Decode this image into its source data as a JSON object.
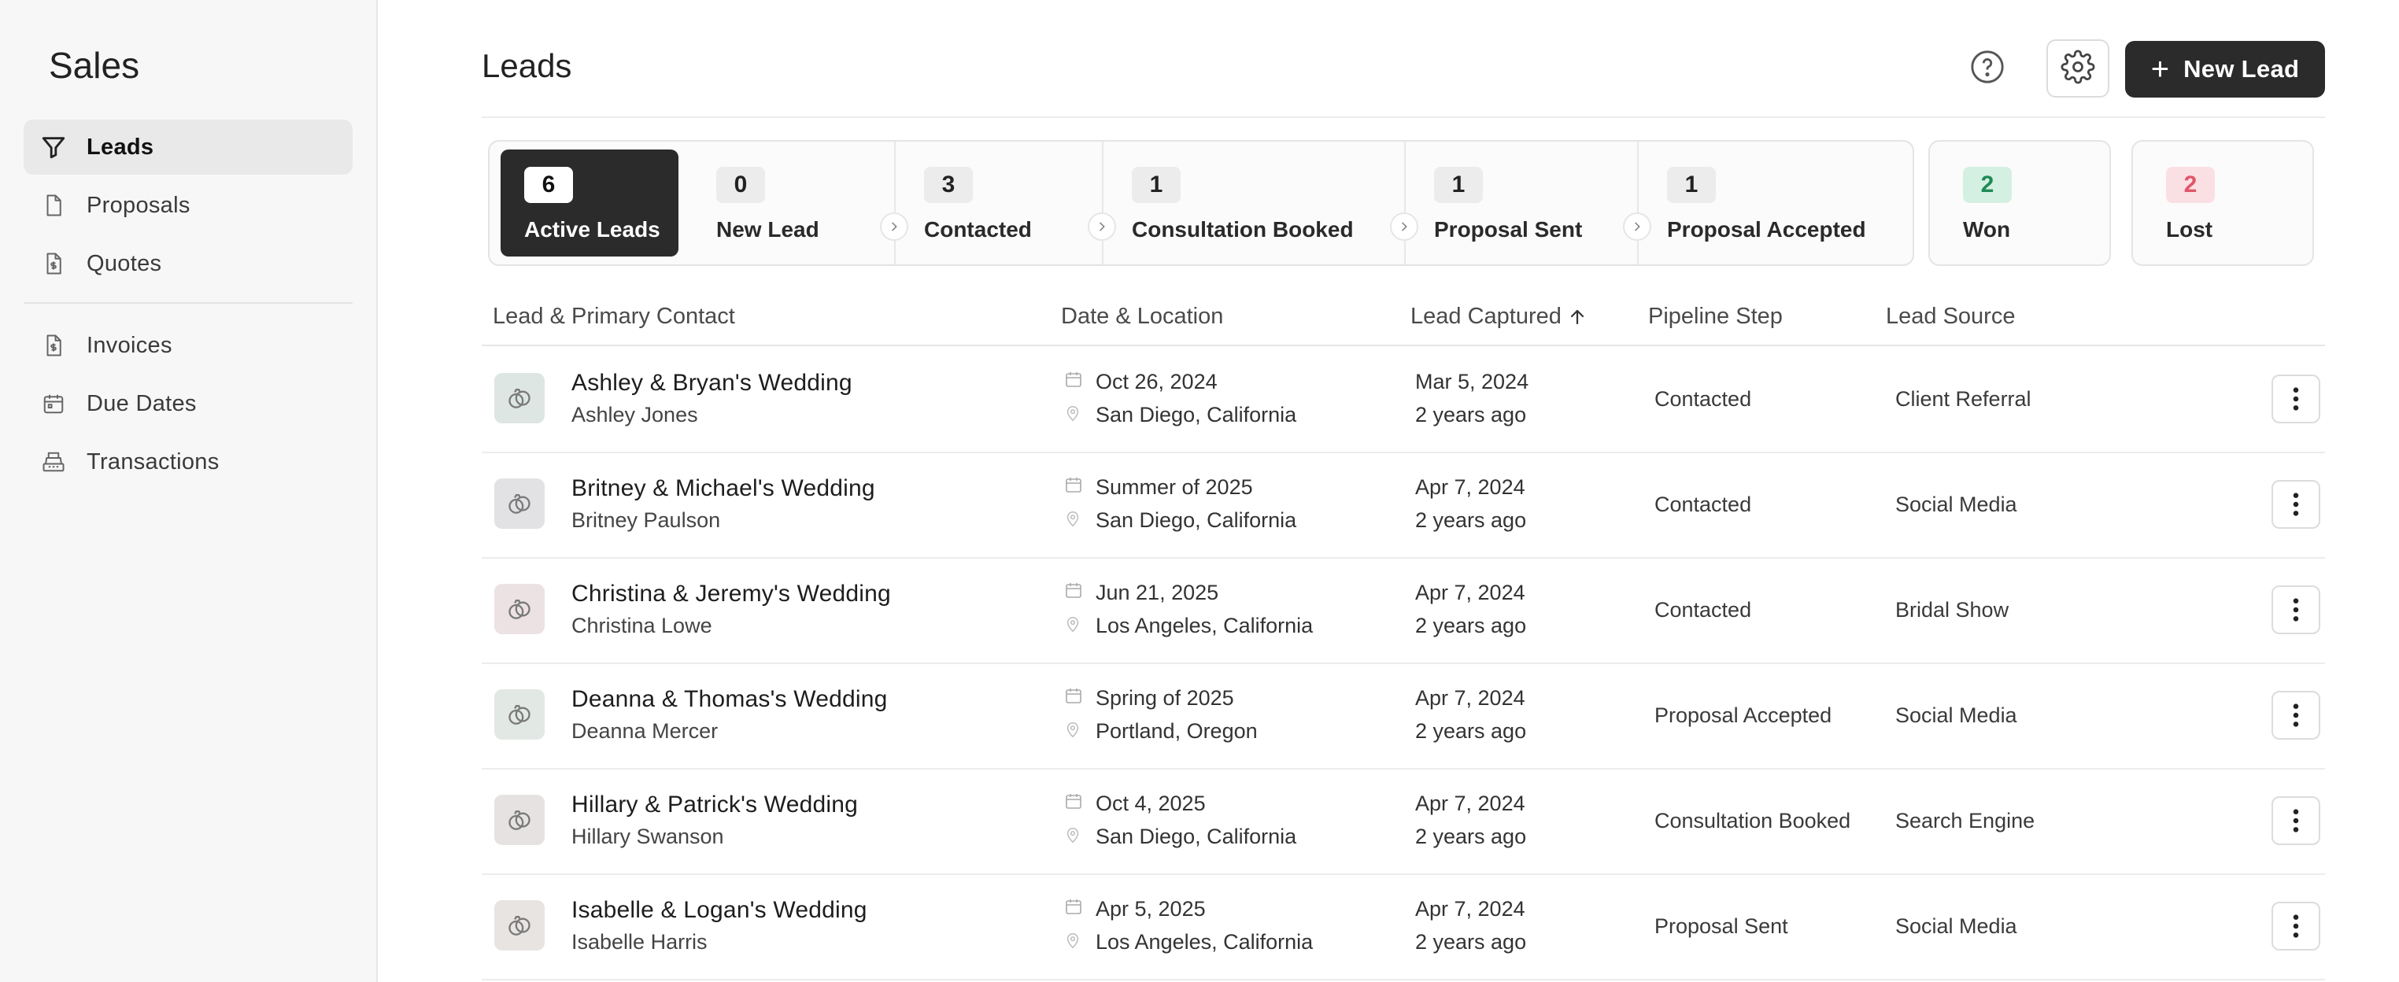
{
  "sidebar": {
    "title": "Sales",
    "items": [
      {
        "label": "Leads",
        "icon": "filter-icon"
      },
      {
        "label": "Proposals",
        "icon": "document-icon"
      },
      {
        "label": "Quotes",
        "icon": "quote-doc-icon"
      },
      {
        "label": "Invoices",
        "icon": "invoice-icon"
      },
      {
        "label": "Due Dates",
        "icon": "calendar-icon"
      },
      {
        "label": "Transactions",
        "icon": "register-icon"
      }
    ]
  },
  "header": {
    "title": "Leads",
    "new_lead_label": "New Lead"
  },
  "pipeline": {
    "stages": [
      {
        "count": "6",
        "label": "Active Leads"
      },
      {
        "count": "0",
        "label": "New Lead"
      },
      {
        "count": "3",
        "label": "Contacted"
      },
      {
        "count": "1",
        "label": "Consultation Booked"
      },
      {
        "count": "1",
        "label": "Proposal Sent"
      },
      {
        "count": "1",
        "label": "Proposal Accepted"
      }
    ],
    "won": {
      "count": "2",
      "label": "Won"
    },
    "lost": {
      "count": "2",
      "label": "Lost"
    }
  },
  "table": {
    "columns": {
      "lead": "Lead & Primary Contact",
      "date_location": "Date & Location",
      "captured": "Lead Captured",
      "step": "Pipeline Step",
      "source": "Lead Source"
    },
    "rows": [
      {
        "name": "Ashley & Bryan's Wedding",
        "contact": "Ashley Jones",
        "date": "Oct 26, 2024",
        "location": "San Diego, California",
        "captured": "Mar 5, 2024",
        "ago": "2 years ago",
        "step": "Contacted",
        "source": "Client Referral"
      },
      {
        "name": "Britney & Michael's Wedding",
        "contact": "Britney Paulson",
        "date": "Summer of 2025",
        "location": "San Diego, California",
        "captured": "Apr 7, 2024",
        "ago": "2 years ago",
        "step": "Contacted",
        "source": "Social Media"
      },
      {
        "name": "Christina & Jeremy's Wedding",
        "contact": "Christina Lowe",
        "date": "Jun 21, 2025",
        "location": "Los Angeles, California",
        "captured": "Apr 7, 2024",
        "ago": "2 years ago",
        "step": "Contacted",
        "source": "Bridal Show"
      },
      {
        "name": "Deanna & Thomas's Wedding",
        "contact": "Deanna Mercer",
        "date": "Spring of 2025",
        "location": "Portland, Oregon",
        "captured": "Apr 7, 2024",
        "ago": "2 years ago",
        "step": "Proposal Accepted",
        "source": "Social Media"
      },
      {
        "name": "Hillary & Patrick's Wedding",
        "contact": "Hillary Swanson",
        "date": "Oct 4, 2025",
        "location": "San Diego, California",
        "captured": "Apr 7, 2024",
        "ago": "2 years ago",
        "step": "Consultation Booked",
        "source": "Search Engine"
      },
      {
        "name": "Isabelle & Logan's Wedding",
        "contact": "Isabelle Harris",
        "date": "Apr 5, 2025",
        "location": "Los Angeles, California",
        "captured": "Apr 7, 2024",
        "ago": "2 years ago",
        "step": "Proposal Sent",
        "source": "Social Media"
      }
    ]
  },
  "colors": {
    "primary_dark": "#2b2b2b",
    "won_bg": "#d4f0e2",
    "won_text": "#1e8a55",
    "lost_bg": "#fbe0e3",
    "lost_text": "#e0566a"
  }
}
